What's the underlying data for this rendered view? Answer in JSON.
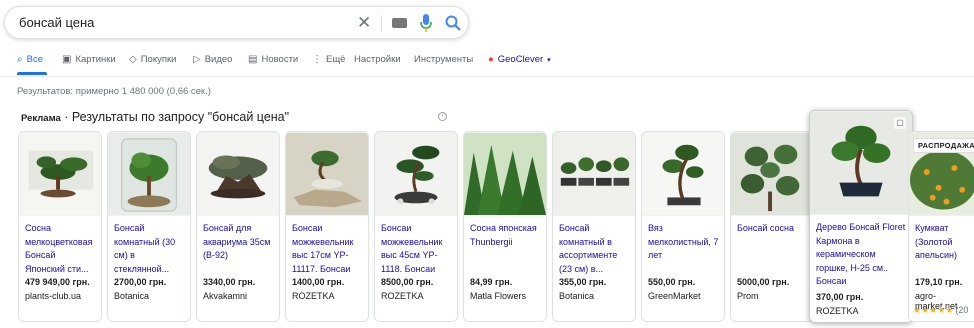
{
  "search": {
    "query": "бонсай цена"
  },
  "tabs": [
    {
      "label": "Все",
      "icon": "search-icon",
      "active": true
    },
    {
      "label": "Картинки",
      "icon": "image-icon"
    },
    {
      "label": "Покупки",
      "icon": "tag-icon"
    },
    {
      "label": "Видео",
      "icon": "play-icon"
    },
    {
      "label": "Новости",
      "icon": "news-icon"
    },
    {
      "label": "Ещё",
      "icon": "more-vert-icon"
    },
    {
      "label": "Настройки"
    },
    {
      "label": "Инструменты"
    },
    {
      "label": "GeoClever",
      "icon": "pin-icon"
    }
  ],
  "stats": "Результатов: примерно 1 480 000 (0,66 сек.)",
  "ads": {
    "label": "Реклама",
    "heading": "Результаты по запросу \"бонсай цена\""
  },
  "products": [
    {
      "title": "Сосна мелкоцветковая Бонсай Японский сти...",
      "price": "479 949,00 грн.",
      "seller": "plants-club.ua"
    },
    {
      "title": "Бонсай комнатный (30 см) в стеклянной...",
      "price": "2700,00 грн.",
      "seller": "Botanica"
    },
    {
      "title": "Бонсай для аквариума 35см (B-92)",
      "price": "3340,00 грн.",
      "seller": "Akvakamni"
    },
    {
      "title": "Бонсаи можжевельник выс 17см YP-11117. Бонсаи",
      "price": "1400,00 грн.",
      "seller": "ROZETKA"
    },
    {
      "title": "Бонсаи можжевельник выс 45см YP-1118. Бонсаи",
      "price": "8500,00 грн.",
      "seller": "ROZETKA"
    },
    {
      "title": "Сосна японская Thunbergii",
      "price": "84,99 грн.",
      "seller": "Matla Flowers"
    },
    {
      "title": "Бонсай комнатный в ассортименте (23 см) в...",
      "price": "355,00 грн.",
      "seller": "Botanica"
    },
    {
      "title": "Вяз мелколистный, 7 лет",
      "price": "550,00 грн.",
      "seller": "GreenMarket"
    },
    {
      "title": "Бонсай сосна",
      "price": "5000,00 грн.",
      "seller": "Prom"
    },
    {
      "title": "Дерево Бонсай Floret Кармона в керамическом горшке, Н-25 см.. Бонсаи",
      "price": "370,00 грн.",
      "seller": "ROZETKA"
    },
    {
      "title": "Кумкват (Золотой апельсин)",
      "price": "179,10 грн.",
      "seller": "agro-market.net",
      "badge": "РАСПРОДАЖА",
      "rating_count": "(20"
    }
  ],
  "colors": {
    "link": "#1a0dab",
    "accent": "#1a73e8",
    "star": "#f4b400"
  }
}
